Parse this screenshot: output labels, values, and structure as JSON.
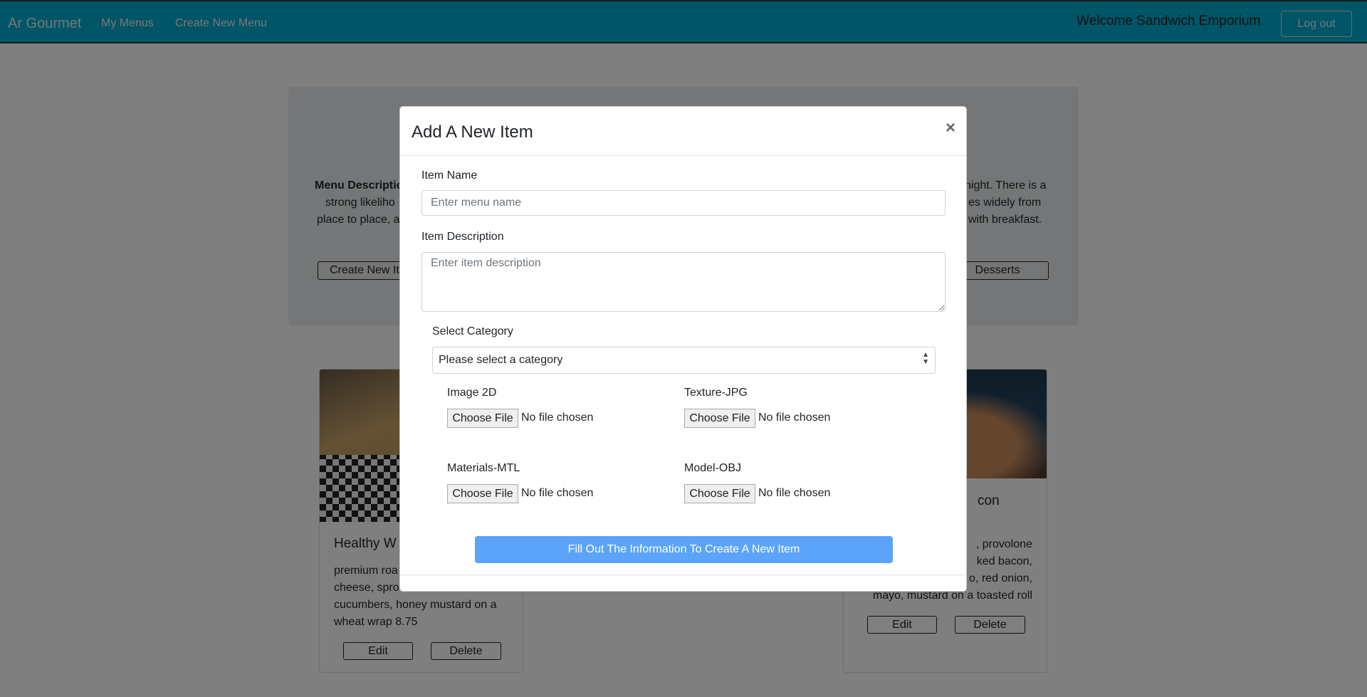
{
  "nav": {
    "brand": "Ar Gourmet",
    "links": [
      "My Menus",
      "Create New Menu"
    ],
    "welcome": "Welcome Sandwich Emporium",
    "logout": "Log out",
    "color": "#00aacc"
  },
  "jumbotron": {
    "desc_left": [
      {
        "bold": "Menu Descriptio",
        "rest": ""
      },
      {
        "bold": "",
        "rest": "strong likeliho"
      },
      {
        "bold": "",
        "rest": "place to place, a"
      }
    ],
    "desc_right": [
      "night. There is a",
      "es widely from",
      "with breakfast."
    ],
    "create_btn": "Create New It",
    "desserts_btn": "Desserts"
  },
  "cards": [
    {
      "title": "Healthy W",
      "desc": [
        "premium roa",
        "cheese, spro",
        "cucumbers, honey mustard on a",
        "wheat wrap 8.75"
      ],
      "edit": "Edit",
      "delete": "Delete"
    },
    {
      "title": "con",
      "desc": [
        ", provolone",
        "ked bacon,",
        "o, red onion,",
        "mayo, mustard on a toasted roll"
      ],
      "edit": "Edit",
      "delete": "Delete"
    }
  ],
  "modal": {
    "title": "Add A New Item",
    "close": "×",
    "item_name_label": "Item Name",
    "item_name_placeholder": "Enter menu name",
    "item_desc_label": "Item Description",
    "item_desc_placeholder": "Enter item description",
    "category_label": "Select Category",
    "category_value": "Please select a category",
    "files": [
      {
        "label": "Image 2D",
        "button": "Choose File",
        "status": "No file chosen"
      },
      {
        "label": "Texture-JPG",
        "button": "Choose File",
        "status": "No file chosen"
      },
      {
        "label": "Materials-MTL",
        "button": "Choose File",
        "status": "No file chosen"
      },
      {
        "label": "Model-OBJ",
        "button": "Choose File",
        "status": "No file chosen"
      }
    ],
    "submit": "Fill Out The Information To Create A New Item",
    "submit_color": "#5ba4f9"
  }
}
